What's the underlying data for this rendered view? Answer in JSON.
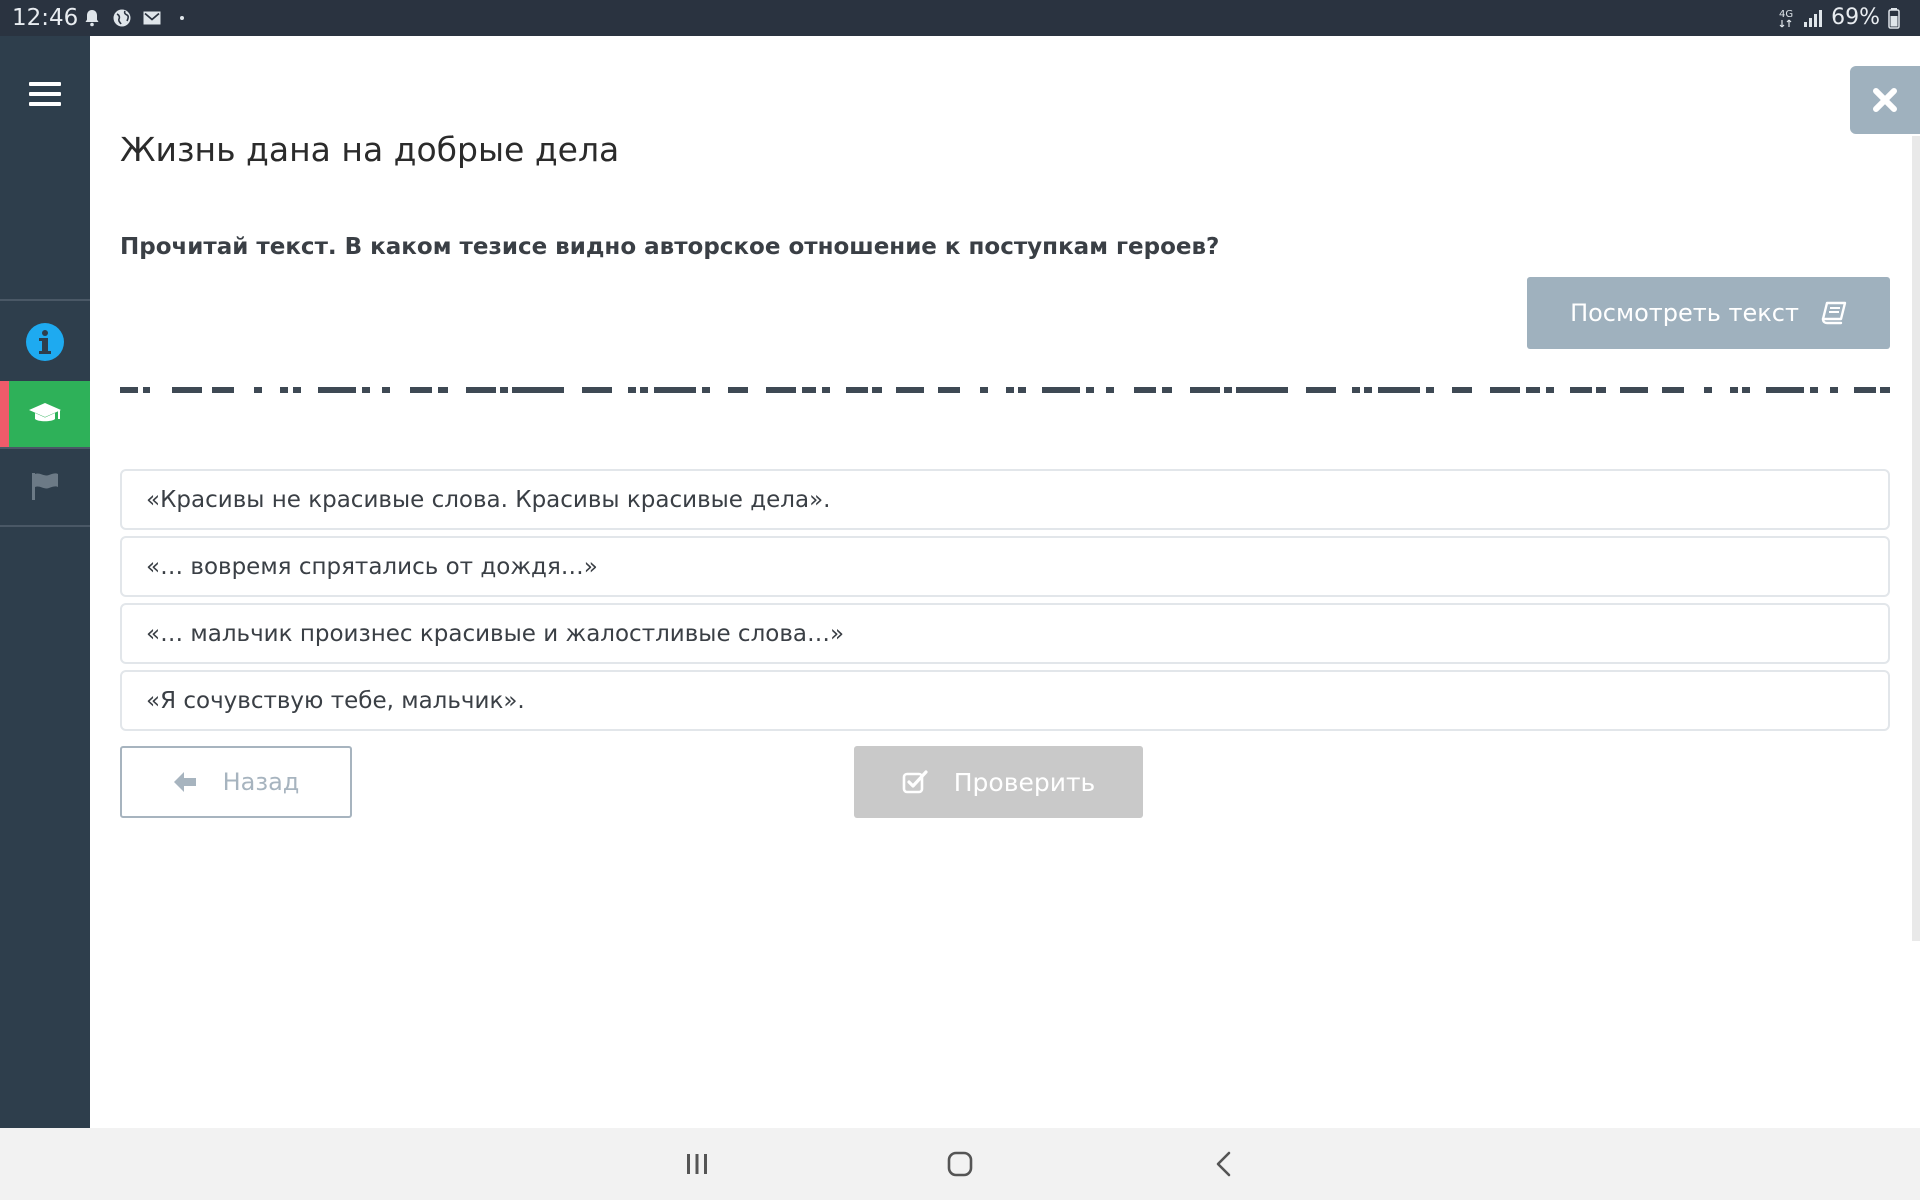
{
  "status_bar": {
    "time": "12:46",
    "network": "4G",
    "battery": "69%",
    "icons": [
      "notification-bell-icon",
      "globe-icon",
      "mail-icon",
      "dot-icon",
      "signal-icon",
      "battery-icon"
    ]
  },
  "sidebar": {
    "items": [
      {
        "name": "menu",
        "icon": "hamburger-icon"
      },
      {
        "name": "info",
        "icon": "info-icon",
        "color": "#1eaaf0"
      },
      {
        "name": "lesson",
        "icon": "graduation-cap-icon",
        "active": true,
        "color": "#2eb159"
      },
      {
        "name": "flag",
        "icon": "flag-icon"
      }
    ]
  },
  "main": {
    "title": "Жизнь дана на добрые дела",
    "question": "Прочитай текст. В каком тезисе видно авторское отношение к поступкам героев?",
    "view_text_button": "Посмотреть текст",
    "answers": [
      "«Красивы не красивые слова. Красивы красивые дела».",
      "«… вовремя спрятались от дождя…»",
      "«… мальчик произнес красивые и жалостливые слова…»",
      "«Я сочувствую тебе, мальчик»."
    ],
    "back_button": "Назад",
    "check_button": "Проверить"
  },
  "colors": {
    "sidebar": "#2e3e4c",
    "accent_green": "#2eb159",
    "accent_red": "#ef5b6a",
    "button_grey_blue": "#9fb1be",
    "check_disabled": "#c9c9c9"
  }
}
